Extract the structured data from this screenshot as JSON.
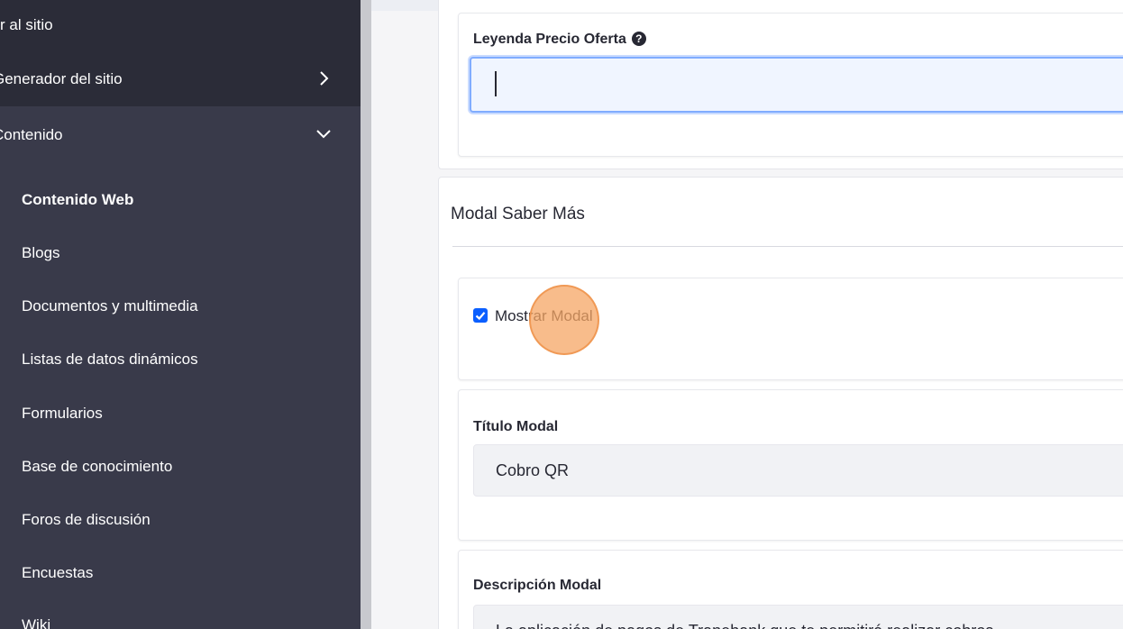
{
  "sidebar": {
    "go_to_site": "r al sitio",
    "site_builder": "Generador del sitio",
    "content": "Contenido",
    "items": [
      {
        "label": "Contenido Web",
        "active": true
      },
      {
        "label": "Blogs"
      },
      {
        "label": "Documentos y multimedia"
      },
      {
        "label": "Listas de datos dinámicos"
      },
      {
        "label": "Formularios"
      },
      {
        "label": "Base de conocimiento"
      },
      {
        "label": "Foros de discusión"
      },
      {
        "label": "Encuestas"
      },
      {
        "label": "Wiki"
      }
    ]
  },
  "form": {
    "offer_price_legend_label": "Leyenda Precio Oferta",
    "offer_price_legend_value": "",
    "modal_section_title": "Modal Saber Más",
    "show_modal_label": "Mostrar Modal",
    "show_modal_checked": true,
    "modal_title_label": "Título Modal",
    "modal_title_value": "Cobro QR",
    "modal_description_label": "Descripción Modal",
    "modal_description_value": "La aplicación de pagos de Tranebank que te permitirá realizar cobros"
  },
  "colors": {
    "sidebar_bg": "#393a4a",
    "accent": "#0b5fff",
    "click_marker": "#f6a564"
  }
}
